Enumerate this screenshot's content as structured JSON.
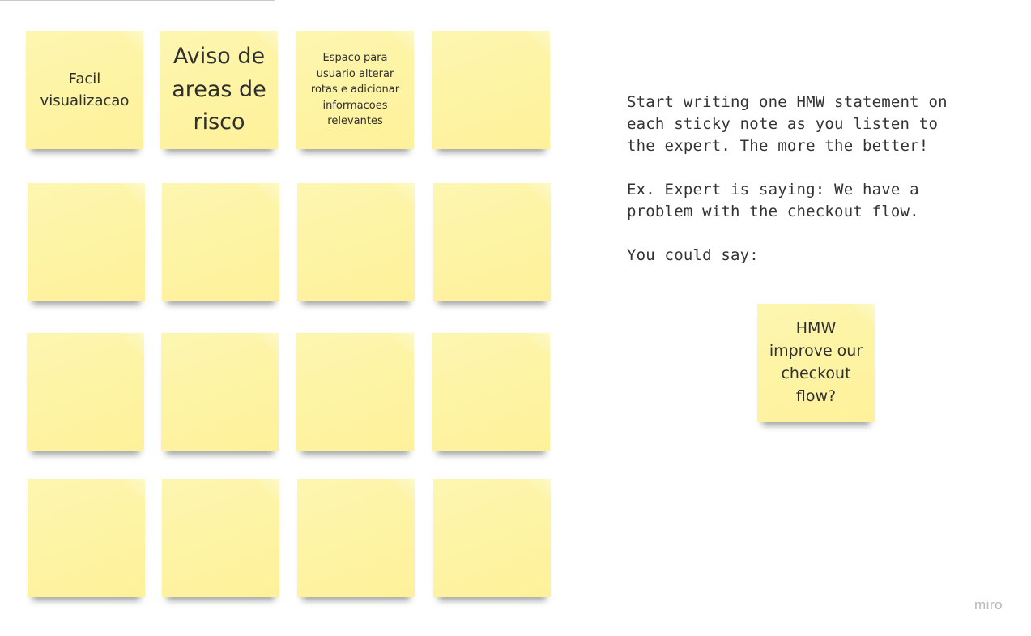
{
  "board": {
    "sticky_notes": [
      {
        "text": "Facil visualizacao"
      },
      {
        "text": "Aviso de areas de risco"
      },
      {
        "text": "Espaco para usuario alterar rotas e adicionar informacoes relevantes"
      },
      {
        "text": ""
      },
      {
        "text": ""
      },
      {
        "text": ""
      },
      {
        "text": ""
      },
      {
        "text": ""
      },
      {
        "text": ""
      },
      {
        "text": ""
      },
      {
        "text": ""
      },
      {
        "text": ""
      },
      {
        "text": ""
      },
      {
        "text": ""
      },
      {
        "text": ""
      },
      {
        "text": ""
      }
    ],
    "sticky_color": "#fdf4a6"
  },
  "instructions": {
    "paragraph1": "Start writing one HMW statement on each sticky note as you listen to the expert. The more the better!",
    "paragraph2": "Ex. Expert is saying: We have a problem with the checkout flow.",
    "paragraph3": "You could say:"
  },
  "example_note": {
    "text": "HMW improve our checkout flow?"
  },
  "brand": {
    "label": "miro"
  }
}
